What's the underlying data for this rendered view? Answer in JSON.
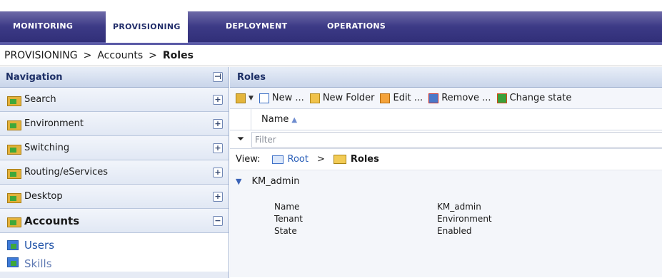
{
  "tabs": [
    "MONITORING",
    "PROVISIONING",
    "DEPLOYMENT",
    "OPERATIONS"
  ],
  "breadcrumb": {
    "items": [
      "PROVISIONING",
      "Accounts",
      "Roles"
    ],
    "separator": ">"
  },
  "nav": {
    "title": "Navigation",
    "collapse_all": "⊣",
    "items": [
      {
        "label": "Search",
        "toggle": "+"
      },
      {
        "label": "Environment",
        "toggle": "+"
      },
      {
        "label": "Switching",
        "toggle": "+"
      },
      {
        "label": "Routing/eServices",
        "toggle": "+"
      },
      {
        "label": "Desktop",
        "toggle": "+"
      },
      {
        "label": "Accounts",
        "toggle": "−"
      }
    ],
    "subitems": [
      "Users",
      "Skills"
    ]
  },
  "panel": {
    "title": "Roles",
    "toolbar": {
      "new": "New ...",
      "new_folder": "New Folder",
      "edit": "Edit ...",
      "remove": "Remove ...",
      "change_state": "Change state"
    },
    "column_name": "Name",
    "sort_arrow": "▲",
    "filter_placeholder": "Filter",
    "view": {
      "label": "View:",
      "root": "Root",
      "separator": ">",
      "current": "Roles"
    },
    "item": {
      "name": "KM_admin",
      "details": [
        {
          "key": "Name",
          "value": "KM_admin"
        },
        {
          "key": "Tenant",
          "value": "Environment"
        },
        {
          "key": "State",
          "value": "Enabled"
        }
      ]
    }
  },
  "colors": {
    "tab_band": "#3c3a86",
    "active_tab_text": "#232f6b",
    "nav_background": "#e6ebf5",
    "link_blue": "#2a5fb8"
  }
}
